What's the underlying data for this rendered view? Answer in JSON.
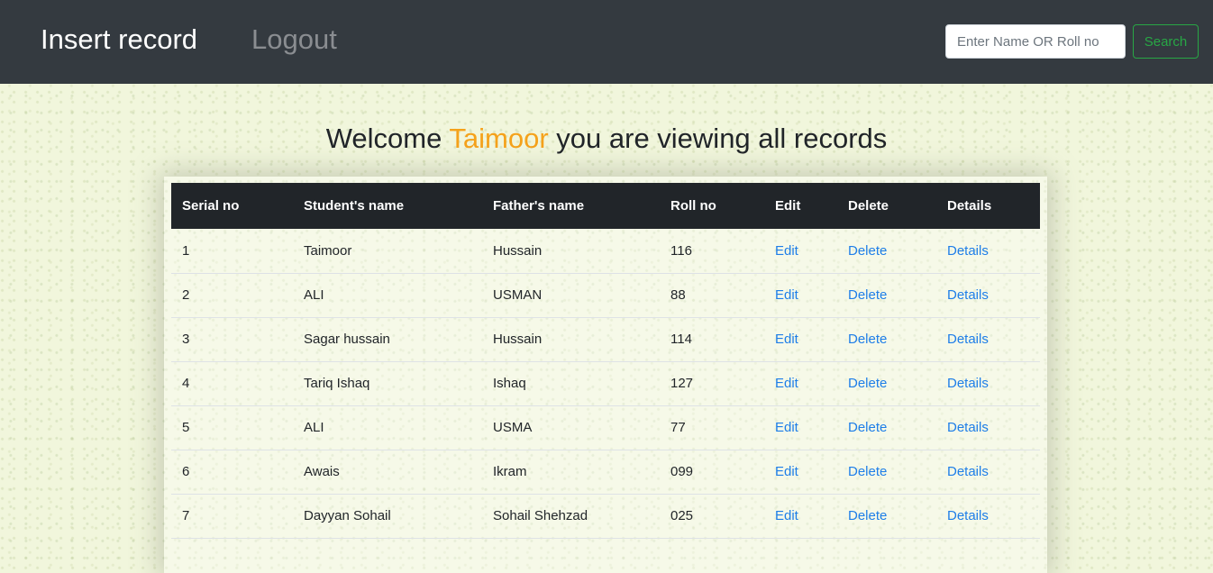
{
  "nav": {
    "insert_label": "Insert record",
    "logout_label": "Logout",
    "search_placeholder": "Enter Name OR Roll no",
    "search_button": "Search"
  },
  "welcome": {
    "prefix": "Welcome",
    "user": "Taimoor",
    "suffix": "you are viewing all records"
  },
  "colors": {
    "navbar": "#343a40",
    "accent_user": "#f5a21b",
    "link": "#1e7ee8",
    "search_button": "#28a745"
  },
  "table": {
    "headers": [
      "Serial no",
      "Student's name",
      "Father's name",
      "Roll no",
      "Edit",
      "Delete",
      "Details"
    ],
    "rows": [
      {
        "serial": "1",
        "student": "Taimoor",
        "father": "Hussain",
        "roll": "116",
        "edit": "Edit",
        "delete": "Delete",
        "details": "Details"
      },
      {
        "serial": "2",
        "student": "ALI",
        "father": "USMAN",
        "roll": "88",
        "edit": "Edit",
        "delete": "Delete",
        "details": "Details"
      },
      {
        "serial": "3",
        "student": "Sagar hussain",
        "father": "Hussain",
        "roll": "114",
        "edit": "Edit",
        "delete": "Delete",
        "details": "Details"
      },
      {
        "serial": "4",
        "student": "Tariq Ishaq",
        "father": "Ishaq",
        "roll": "127",
        "edit": "Edit",
        "delete": "Delete",
        "details": "Details"
      },
      {
        "serial": "5",
        "student": "ALI",
        "father": "USMA",
        "roll": "77",
        "edit": "Edit",
        "delete": "Delete",
        "details": "Details"
      },
      {
        "serial": "6",
        "student": "Awais",
        "father": "Ikram",
        "roll": "099",
        "edit": "Edit",
        "delete": "Delete",
        "details": "Details"
      },
      {
        "serial": "7",
        "student": "Dayyan Sohail",
        "father": "Sohail Shehzad",
        "roll": "025",
        "edit": "Edit",
        "delete": "Delete",
        "details": "Details"
      }
    ]
  }
}
